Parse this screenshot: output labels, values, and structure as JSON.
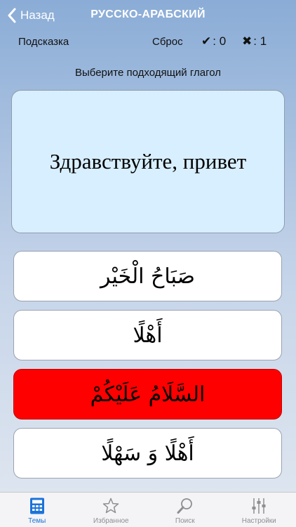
{
  "navbar": {
    "back_label": "Назад",
    "title": "РУССКО-АРАБСКИЙ"
  },
  "toolbar": {
    "hint_label": "Подсказка",
    "reset_label": "Сброс",
    "correct_glyph": "✔",
    "correct_count": ": 0",
    "wrong_glyph": "✖",
    "wrong_count": ": 1"
  },
  "instruction": "Выберите подходящий глагол",
  "question": "Здравствуйте, привет",
  "answers": [
    {
      "text": "صَبَاحُ الْخَيْر",
      "state": "normal"
    },
    {
      "text": "أَهْلًا",
      "state": "normal"
    },
    {
      "text": "السَّلَامُ عَلَيْكُمْ",
      "state": "wrong"
    },
    {
      "text": "أَهْلًا وَ سَهْلًا",
      "state": "normal"
    }
  ],
  "tabs": [
    {
      "label": "Темы",
      "icon": "calculator-icon",
      "active": true
    },
    {
      "label": "Избранное",
      "icon": "star-icon",
      "active": false
    },
    {
      "label": "Поиск",
      "icon": "search-icon",
      "active": false
    },
    {
      "label": "Настройки",
      "icon": "sliders-icon",
      "active": false
    }
  ],
  "colors": {
    "accent": "#1a73d9",
    "wrong_answer": "#ff0000",
    "question_bg": "#d8efff",
    "inactive_tab": "#8e8e93"
  }
}
